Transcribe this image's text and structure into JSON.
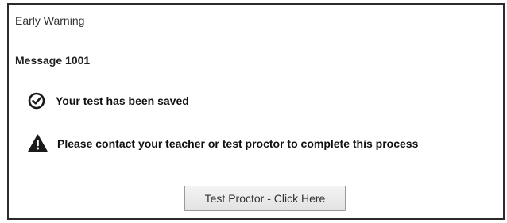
{
  "dialog": {
    "title": "Early Warning",
    "message_id": "Message 1001",
    "saved_status": {
      "icon": "check-circle-icon",
      "text": "Your test has been saved"
    },
    "warning_status": {
      "icon": "warning-triangle-icon",
      "text": "Please contact your teacher or test proctor to complete this process"
    },
    "action_button_label": "Test Proctor - Click Here"
  },
  "colors": {
    "border": "#2b2b2b",
    "icon": "#1a1a1a",
    "button_bg": "#e9e9e9"
  }
}
